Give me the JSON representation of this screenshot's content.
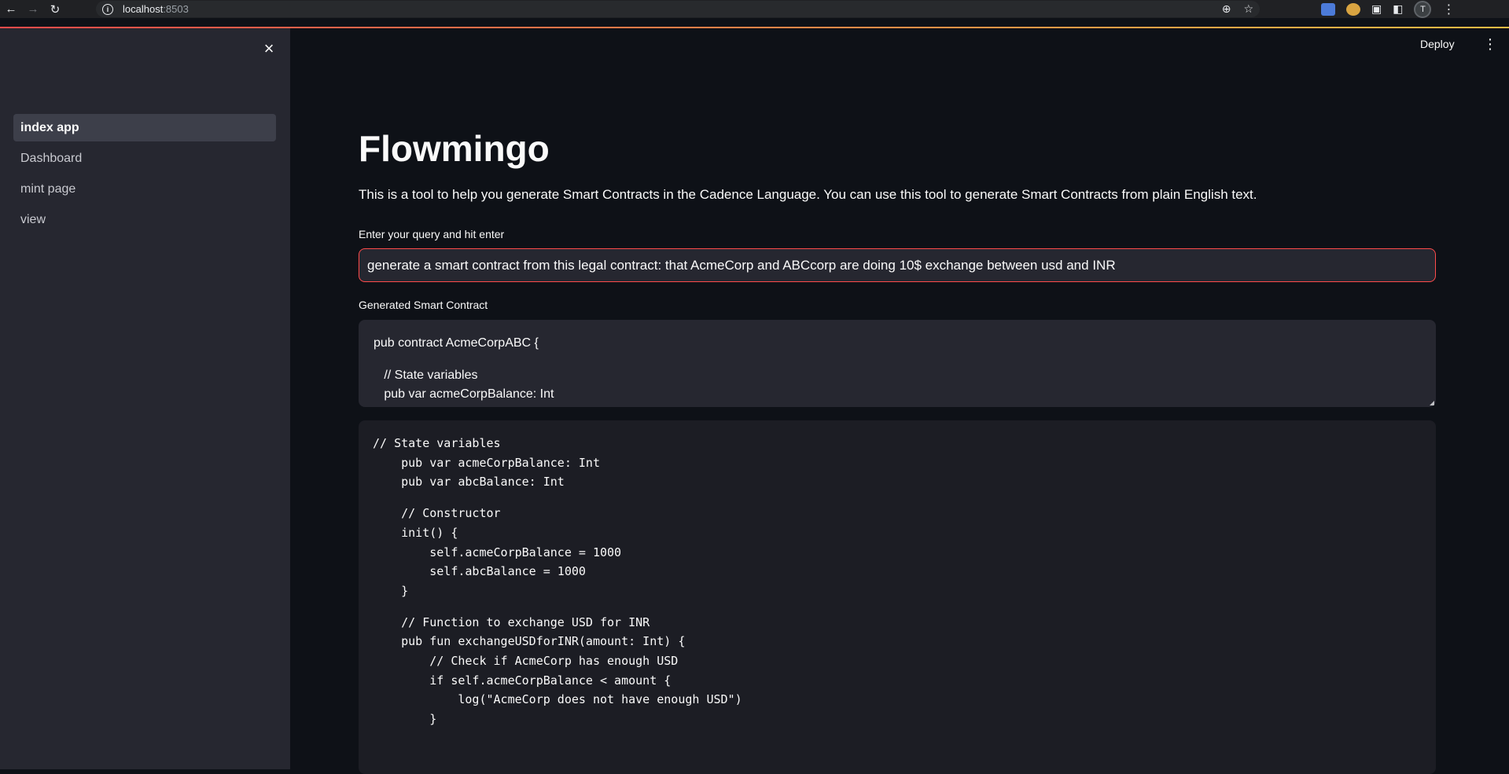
{
  "browser": {
    "url_host": "localhost",
    "url_port": ":8503",
    "profile_initial": "T"
  },
  "sidebar": {
    "items": [
      {
        "label": "index app",
        "active": true
      },
      {
        "label": "Dashboard",
        "active": false
      },
      {
        "label": "mint page",
        "active": false
      },
      {
        "label": "view",
        "active": false
      }
    ]
  },
  "header": {
    "deploy_label": "Deploy"
  },
  "main": {
    "title": "Flowmingo",
    "description": "This is a tool to help you generate Smart Contracts in the Cadence Language. You can use this tool to generate Smart Contracts from plain English text.",
    "query_label": "Enter your query and hit enter",
    "query_value": "generate a smart contract from this legal contract: that AcmeCorp and ABCcorp are doing 10$ exchange between usd and INR",
    "generated_label": "Generated Smart Contract",
    "generated_lines": [
      "pub contract AcmeCorpABC {",
      "",
      "   // State variables",
      "   pub var acmeCorpBalance: Int"
    ],
    "code_lines": [
      "// State variables",
      "    pub var acmeCorpBalance: Int",
      "    pub var abcBalance: Int",
      "",
      "    // Constructor",
      "    init() {",
      "        self.acmeCorpBalance = 1000",
      "        self.abcBalance = 1000",
      "    }",
      "",
      "    // Function to exchange USD for INR",
      "    pub fun exchangeUSDforINR(amount: Int) {",
      "        // Check if AcmeCorp has enough USD",
      "        if self.acmeCorpBalance < amount {",
      "            log(\"AcmeCorp does not have enough USD\")",
      "        }"
    ]
  },
  "colors": {
    "accent": "#ff4b4b",
    "sidebar_bg": "#262730",
    "main_bg": "#0e1117"
  }
}
